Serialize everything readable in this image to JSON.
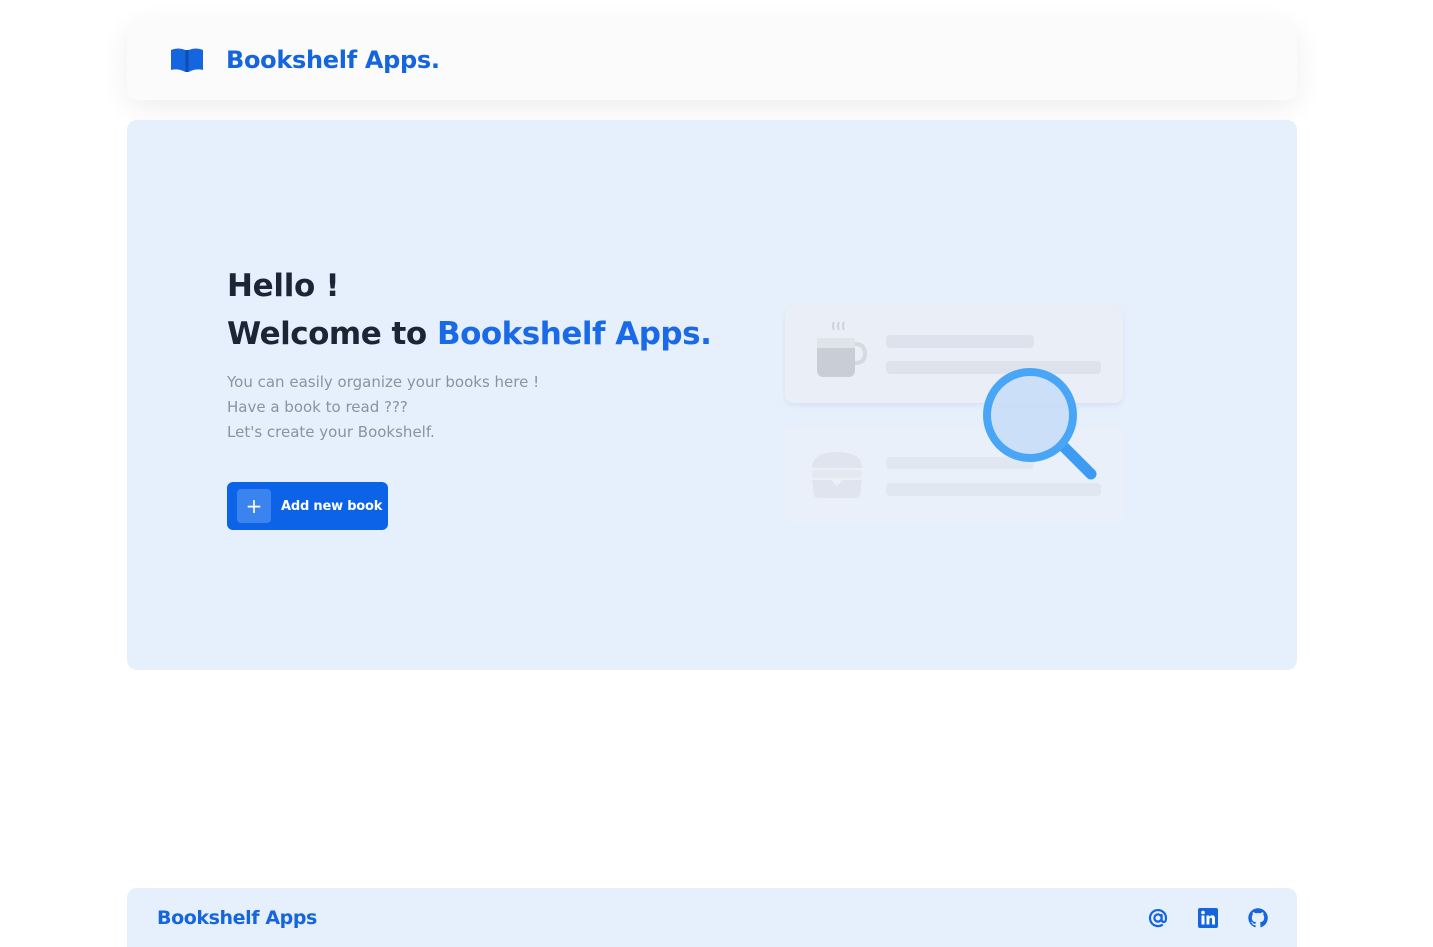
{
  "colors": {
    "brand": "#1565df",
    "hero_bg": "#e6f0fd",
    "button_bg": "#0c63e7",
    "heading": "#1c2536",
    "muted_text": "#8b92a0"
  },
  "navbar": {
    "logo_icon": "open-book-icon",
    "brand": "Bookshelf Apps."
  },
  "hero": {
    "greeting": "Hello !",
    "welcome_prefix": "Welcome to",
    "welcome_brand": "Bookshelf Apps.",
    "description": [
      "You can easily organize your books here !",
      "Have a book to read ???",
      "Let's create your Bookshelf."
    ],
    "add_button": {
      "icon": "plus-icon",
      "plus_symbol": "+",
      "label": "Add new book"
    },
    "illustration": "search-list-illustration"
  },
  "footer": {
    "brand": "Bookshelf Apps",
    "icons": [
      "at-sign-icon",
      "linkedin-icon",
      "github-icon"
    ]
  }
}
